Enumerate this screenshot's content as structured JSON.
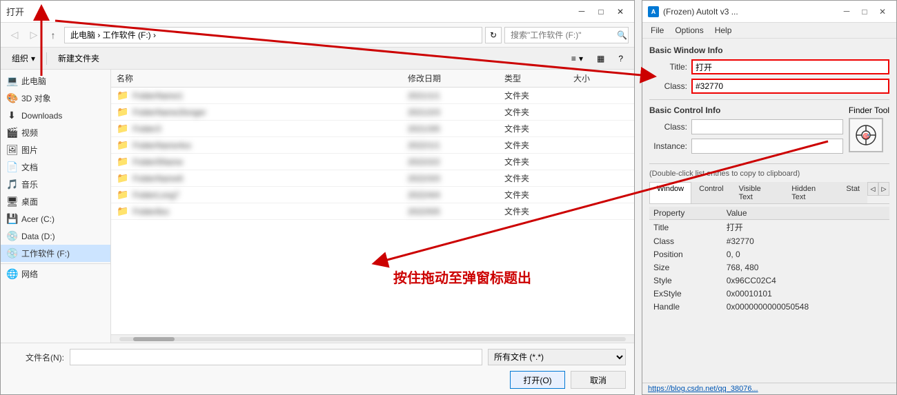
{
  "fileDialog": {
    "title": "打开",
    "navBtns": {
      "back": "←",
      "forward": "→",
      "up": "↑"
    },
    "addressPath": "此电脑 › 工作软件 (F:) ›",
    "refreshBtn": "↻",
    "searchPlaceholder": "搜索\"工作软件 (F:)\"",
    "searchIcon": "🔍",
    "toolbar": {
      "organize": "组织",
      "organize_arrow": "▾",
      "newFolder": "新建文件夹",
      "viewIcon": "≡",
      "viewArrow": "▾",
      "layoutIcon": "▦",
      "helpIcon": "?"
    },
    "navPanel": {
      "items": [
        {
          "icon": "💻",
          "label": "此电脑"
        },
        {
          "icon": "🎨",
          "label": "3D 对象"
        },
        {
          "icon": "⬇",
          "label": "Downloads"
        },
        {
          "icon": "🎬",
          "label": "视频"
        },
        {
          "icon": "🖼",
          "label": "图片"
        },
        {
          "icon": "📄",
          "label": "文档"
        },
        {
          "icon": "🎵",
          "label": "音乐"
        },
        {
          "icon": "🖥",
          "label": "桌面"
        },
        {
          "icon": "💾",
          "label": "Acer (C:)"
        },
        {
          "icon": "💿",
          "label": "Data (D:)"
        },
        {
          "icon": "💿",
          "label": "工作软件 (F:)",
          "active": true
        },
        {
          "icon": "🌐",
          "label": "网络"
        }
      ]
    },
    "fileList": {
      "headers": [
        "名称",
        "修改日期",
        "类型",
        "大小"
      ],
      "rows": [
        {
          "name": "blurred1",
          "date": "",
          "type": "文件夹",
          "size": ""
        },
        {
          "name": "blurred2",
          "date": "",
          "type": "文件夹",
          "size": ""
        },
        {
          "name": "blurred3",
          "date": "",
          "type": "文件夹",
          "size": ""
        },
        {
          "name": "blurred4",
          "date": "",
          "type": "文件夹",
          "size": ""
        },
        {
          "name": "blurred5",
          "date": "",
          "type": "文件夹",
          "size": ""
        },
        {
          "name": "blurred6",
          "date": "",
          "type": "文件夹",
          "size": ""
        },
        {
          "name": "blurred7",
          "date": "",
          "type": "文件夹",
          "size": ""
        },
        {
          "name": "blurred8",
          "date": "",
          "type": "文件夹",
          "size": ""
        }
      ]
    },
    "bottom": {
      "filenameLabel": "文件名(N):",
      "filenameValue": "",
      "filenamePlaceholder": "",
      "filetypeValue": "所有文件 (*.*)",
      "openBtn": "打开(O)",
      "cancelBtn": "取消"
    }
  },
  "autoitWindow": {
    "title": "(Frozen) AutoIt v3 ...",
    "titleIcon": "A",
    "menuItems": [
      "File",
      "Options",
      "Help"
    ],
    "basicWindowInfo": {
      "sectionLabel": "Basic Window Info",
      "titleLabel": "Title:",
      "titleValue": "打开",
      "classLabel": "Class:",
      "classValue": "#32770"
    },
    "basicControlInfo": {
      "sectionLabel": "Basic Control Info",
      "finderToolLabel": "Finder Tool",
      "classLabel": "Class:",
      "classValue": "",
      "instanceLabel": "Instance:",
      "instanceValue": ""
    },
    "listNote": "(Double-click list entries to copy to clipboard)",
    "tabs": [
      "Window",
      "Control",
      "Visible Text",
      "Hidden Text",
      "Stat"
    ],
    "activeTab": "Window",
    "tableHeaders": [
      "Property",
      "Value"
    ],
    "tableRows": [
      {
        "property": "Title",
        "value": "打开"
      },
      {
        "property": "Class",
        "value": "#32770"
      },
      {
        "property": "Position",
        "value": "0, 0"
      },
      {
        "property": "Size",
        "value": "768, 480"
      },
      {
        "property": "Style",
        "value": "0x96CC02C4"
      },
      {
        "property": "ExStyle",
        "value": "0x00010101"
      },
      {
        "property": "Handle",
        "value": "0x0000000000050548"
      }
    ],
    "statusbar": "https://blog.csdn.net/qq_38076..."
  },
  "annotation": {
    "dragText": "按住拖动至弹窗标题出"
  }
}
